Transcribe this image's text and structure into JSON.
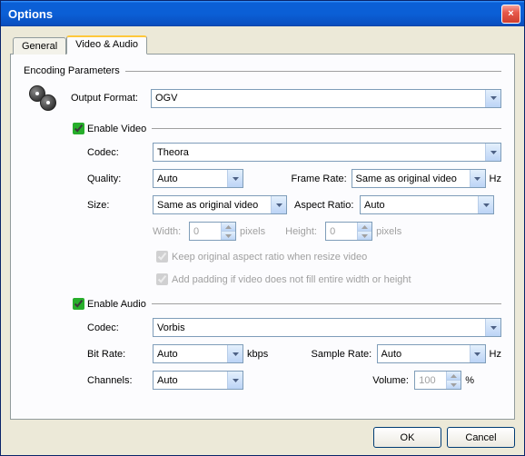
{
  "window": {
    "title": "Options",
    "close": "×"
  },
  "tabs": {
    "general": "General",
    "video_audio": "Video & Audio"
  },
  "encoding_header": "Encoding Parameters",
  "labels": {
    "output_format": "Output Format:",
    "enable_video": "Enable Video",
    "codec": "Codec:",
    "quality": "Quality:",
    "frame_rate": "Frame Rate:",
    "hz": "Hz",
    "size": "Size:",
    "aspect_ratio": "Aspect Ratio:",
    "width": "Width:",
    "height": "Height:",
    "pixels": "pixels",
    "keep_aspect": "Keep original aspect ratio when resize video",
    "add_padding": "Add padding if video does not fill entire width or height",
    "enable_audio": "Enable Audio",
    "bit_rate": "Bit Rate:",
    "kbps": "kbps",
    "sample_rate": "Sample Rate:",
    "channels": "Channels:",
    "volume": "Volume:",
    "percent": "%"
  },
  "values": {
    "output_format": "OGV",
    "video_codec": "Theora",
    "quality": "Auto",
    "frame_rate": "Same as original video",
    "size": "Same as original video",
    "aspect_ratio": "Auto",
    "width": "0",
    "height": "0",
    "audio_codec": "Vorbis",
    "bit_rate": "Auto",
    "sample_rate": "Auto",
    "channels": "Auto",
    "volume": "100"
  },
  "buttons": {
    "ok": "OK",
    "cancel": "Cancel"
  }
}
